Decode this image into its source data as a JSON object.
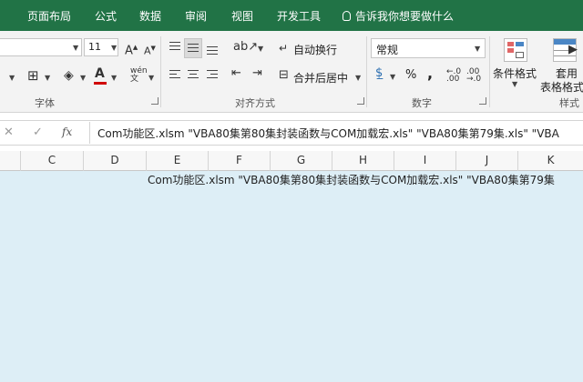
{
  "tabs": [
    "页面布局",
    "公式",
    "数据",
    "审阅",
    "视图",
    "开发工具"
  ],
  "tell_me": "告诉我你想要做什么",
  "font": {
    "size": "11"
  },
  "groups": {
    "font_label": "字体",
    "align_label": "对齐方式",
    "number_label": "数字",
    "styles_label": "样式"
  },
  "alignment": {
    "wrap_text": "自动换行",
    "merge_center": "合并后居中"
  },
  "number": {
    "format": "常规",
    "percent": "%",
    "comma": ","
  },
  "styles": {
    "conditional": "条件格式",
    "format_table_l1": "套用",
    "format_table_l2": "表格格式"
  },
  "formula_bar": {
    "fx": "fx",
    "text": "Com功能区.xlsm \"VBA80集第80集封装函数与COM加载宏.xls\" \"VBA80集第79集.xls\" \"VBA"
  },
  "columns": [
    "C",
    "D",
    "E",
    "F",
    "G",
    "H",
    "I",
    "J",
    "K"
  ],
  "cell": {
    "text": "Com功能区.xlsm \"VBA80集第80集封装函数与COM加载宏.xls\" \"VBA80集第79集"
  },
  "colors": {
    "accent": "#217346",
    "sheet_bg": "#ddeef6",
    "font_red": "#d00000"
  }
}
